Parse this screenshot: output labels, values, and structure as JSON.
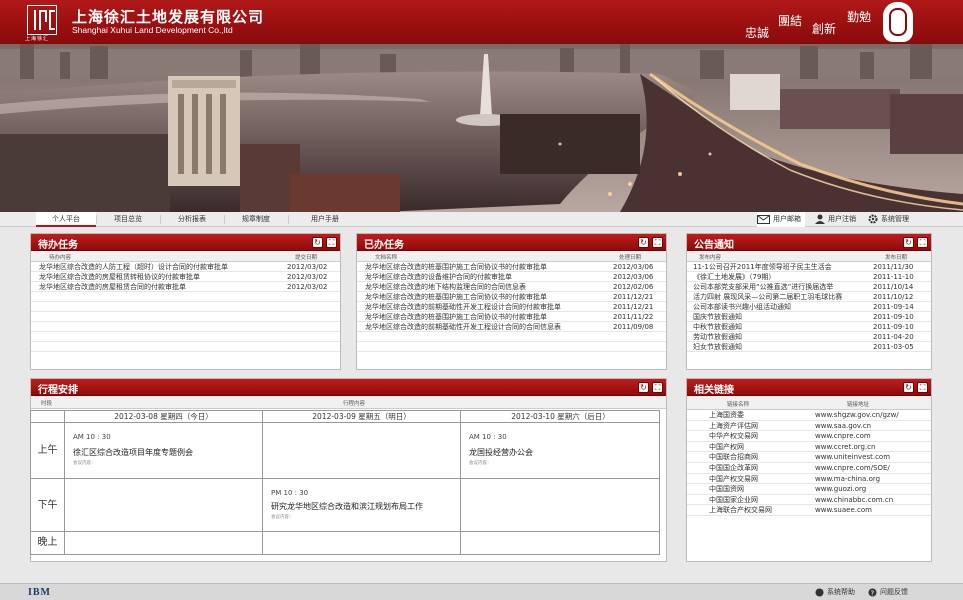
{
  "header": {
    "logo_sub": "上海徐汇",
    "company_cn": "上海徐汇土地发展有限公司",
    "company_en": "Shanghai Xuhui Land Development Co.,ltd",
    "motto": [
      "忠誠",
      "團結",
      "創新",
      "勤勉"
    ]
  },
  "nav": {
    "tabs": [
      "个人平台",
      "项目总览",
      "分析报表",
      "规章制度",
      "用户手册"
    ],
    "active_tab": "个人平台",
    "utils": {
      "mail": "用户邮箱",
      "logout": "用户注销",
      "admin": "系统管理"
    }
  },
  "pending": {
    "title": "待办任务",
    "col1": "待办内容",
    "col2": "提交日期",
    "rows": [
      {
        "text": "龙华地区综合改造的人防工程（超时）设计合同的付款审批单",
        "date": "2012/03/02"
      },
      {
        "text": "龙华地区综合改造的房屋租赁转租协议的付款审批单",
        "date": "2012/03/02"
      },
      {
        "text": "龙华地区综合改造的房屋租赁合同的付款审批单",
        "date": "2012/03/02"
      }
    ]
  },
  "done": {
    "title": "已办任务",
    "col1": "文档名称",
    "col2": "处理日期",
    "rows": [
      {
        "text": "龙华地区综合改造的桩基围护施工合同协议书的付款审批单",
        "date": "2012/03/06"
      },
      {
        "text": "龙华地区综合改造的设备维护合同的付款审批单",
        "date": "2012/03/06"
      },
      {
        "text": "龙华地区综合改造的地下结构监理合同的合同信息表",
        "date": "2012/02/06"
      },
      {
        "text": "龙华地区综合改造的桩基围护施工合同协议书的付款审批单",
        "date": "2011/12/21"
      },
      {
        "text": "龙华地区综合改造的前期基础性开发工程设计合同的付款审批单",
        "date": "2011/12/21"
      },
      {
        "text": "龙华地区综合改造的桩基围护施工合同协议书的付款审批单",
        "date": "2011/11/22"
      },
      {
        "text": "龙华地区综合改造的前期基础性开发工程设计合同的合同信息表",
        "date": "2011/09/08"
      }
    ]
  },
  "notice": {
    "title": "公告通知",
    "col1": "发布内容",
    "col2": "发布日期",
    "rows": [
      {
        "text": "11-1公司召开2011年度领导班子民主生活会",
        "date": "2011/11/30"
      },
      {
        "text": "《徐汇土地发展》（79期）",
        "date": "2011-11-10"
      },
      {
        "text": "公司本部党支部采用“公推直选”进行换届选举",
        "date": "2011/10/14"
      },
      {
        "text": "活力四射 展现风采—公司第二届职工羽毛球比赛",
        "date": "2011/10/12"
      },
      {
        "text": "公司本部读书兴趣小组活动通知",
        "date": "2011-09-14"
      },
      {
        "text": "国庆节放假通知",
        "date": "2011-09-10"
      },
      {
        "text": "中秋节放假通知",
        "date": "2011-09-10"
      },
      {
        "text": "劳动节放假通知",
        "date": "2011-04-20"
      },
      {
        "text": "妇女节放假通知",
        "date": "2011-03-05"
      }
    ]
  },
  "schedule": {
    "title": "行程安排",
    "col1": "时段",
    "col2": "行程内容",
    "days": [
      "2012-03-08 星期四（今日）",
      "2012-03-09 星期五（明日）",
      "2012-03-10 星期六（后日）"
    ],
    "periods": [
      "上午",
      "下午",
      "晚上"
    ],
    "events": {
      "am_d1": {
        "time": "AM  10 : 30",
        "title": "徐汇区综合改造项目年度专题例会",
        "sub": "会议内容："
      },
      "am_d3": {
        "time": "AM  10 : 30",
        "title": "龙国投经营办公会",
        "sub": "会议内容："
      },
      "pm_d2": {
        "time": "PM  10 : 30",
        "title": "研究龙华地区综合改造和滨江规划布局工作",
        "sub": "会议内容："
      }
    }
  },
  "links": {
    "title": "相关链接",
    "col1": "链接名称",
    "col2": "链接地址",
    "rows": [
      {
        "name": "上海国资委",
        "url": "www.shgzw.gov.cn/gzw/"
      },
      {
        "name": "上海资产评估网",
        "url": "www.saa.gov.cn"
      },
      {
        "name": "中华产权交易网",
        "url": "www.cnpre.com"
      },
      {
        "name": "中国产权网",
        "url": "www.ccret.org.cn"
      },
      {
        "name": "中国联合招商网",
        "url": "www.uniteinvest.com"
      },
      {
        "name": "中国国企改革网",
        "url": "www.cnpre.com/SOE/"
      },
      {
        "name": "中国产权交易网",
        "url": "www.ma-china.org"
      },
      {
        "name": "中国国资网",
        "url": "www.guozi.org"
      },
      {
        "name": "中国国家企业网",
        "url": "www.chinabbc.com.cn"
      },
      {
        "name": "上海联合产权交易网",
        "url": "www.suaee.com"
      }
    ]
  },
  "footer": {
    "brand": "IBM",
    "help": "系统帮助",
    "feedback": "问题反馈"
  },
  "colors": {
    "brand_red": "#b01818",
    "dark_red": "#8a0a0a"
  }
}
